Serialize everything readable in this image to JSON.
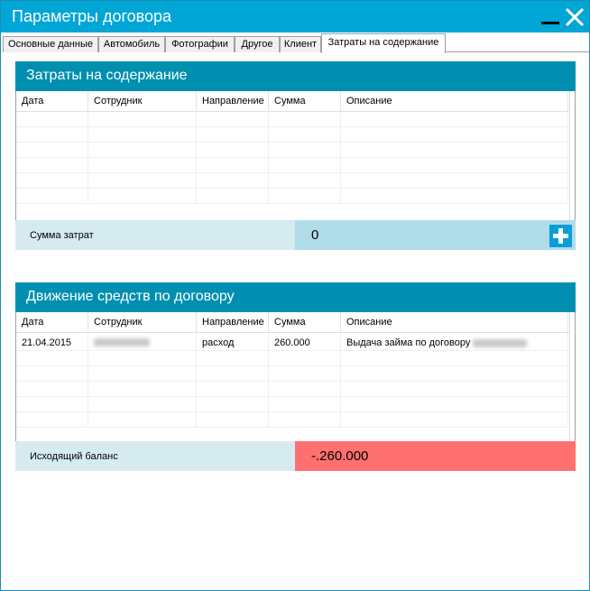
{
  "window": {
    "title": "Параметры договора",
    "minimize_icon": "minimize-icon",
    "close_icon": "close-icon"
  },
  "tabs": [
    {
      "label": "Основные данные"
    },
    {
      "label": "Автомобиль"
    },
    {
      "label": "Фотографии"
    },
    {
      "label": "Другое"
    },
    {
      "label": "Клиент"
    },
    {
      "label": "Затраты на содержание",
      "active": true
    }
  ],
  "expenses": {
    "title": "Затраты на содержание",
    "columns": [
      "Дата",
      "Сотрудник",
      "Направление",
      "Сумма",
      "Описание"
    ],
    "rows": [],
    "total_label": "Сумма затрат",
    "total_value": "0",
    "add_icon": "plus-icon"
  },
  "movements": {
    "title": "Движение средств по договору",
    "columns": [
      "Дата",
      "Сотрудник",
      "Направление",
      "Сумма",
      "Описание"
    ],
    "rows": [
      {
        "date": "21.04.2015",
        "employee": "",
        "direction": "расход",
        "amount": "260.000",
        "description": "Выдача займа по договору"
      }
    ],
    "balance_label": "Исходящий баланс",
    "balance_value": "-.260.000"
  },
  "colors": {
    "titlebar": "#00a6d6",
    "panel_header": "#008fb0",
    "footer_label_bg": "#d6ebf0",
    "footer_value_bg": "#b0dcea",
    "negative_bg": "#ff7070"
  }
}
